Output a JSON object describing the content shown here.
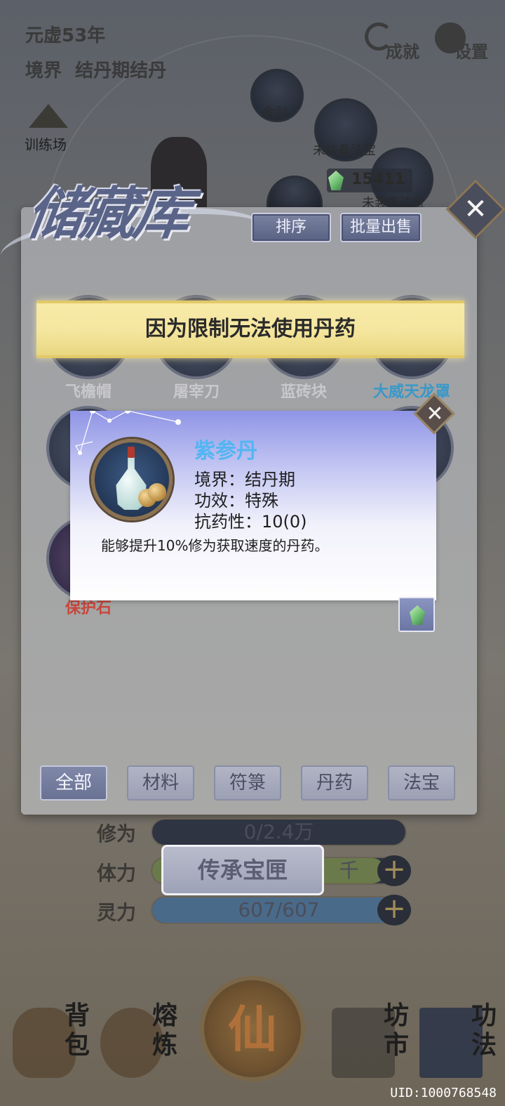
{
  "hud": {
    "year": "元虚53年",
    "realm_label": "境界",
    "realm_value": "结丹期结丹",
    "achievements_label": "成就",
    "settings_label": "设置",
    "training_ground": "训练场"
  },
  "equipment": {
    "slot_sword": "金剑",
    "slot_treasure_1": "未装备法宝",
    "slot_treasure_2": "未装备法宝",
    "currency": "15411"
  },
  "storage": {
    "title": "储藏库",
    "sort_label": "排序",
    "bulk_sell_label": "批量出售",
    "items": [
      {
        "name": "飞檐帽",
        "color": "#c8c8cc"
      },
      {
        "name": "屠宰刀",
        "color": "#c8c8cc"
      },
      {
        "name": "蓝砖块",
        "color": "#c8c8cc"
      },
      {
        "name": "大威天龙罩",
        "color": "#3a98c8"
      },
      {
        "name": "保护石",
        "color": "#c8463a"
      }
    ],
    "tabs": [
      "全部",
      "材料",
      "符箓",
      "丹药",
      "法宝"
    ],
    "active_tab": "全部"
  },
  "toast": {
    "message": "因为限制无法使用丹药"
  },
  "item_detail": {
    "name": "紫参丹",
    "realm": "境界：结丹期",
    "effect": "功效：特殊",
    "resistance": "抗药性：10(0)",
    "description": "能够提升10%修为获取速度的丹药。",
    "name_color": "#52b6f2"
  },
  "stats": {
    "cultivation_label": "修为",
    "cultivation_value": "0/2.4万",
    "stamina_label": "体力",
    "stamina_value_visible": "千",
    "spirit_label": "灵力",
    "spirit_value": "607/607"
  },
  "legacy_box_label": "传承宝匣",
  "bottom_nav": {
    "backpack": "背包",
    "smelt": "熔炼",
    "center": "仙",
    "market": "坊市",
    "skills": "功法"
  },
  "uid": "UID:1000768548"
}
